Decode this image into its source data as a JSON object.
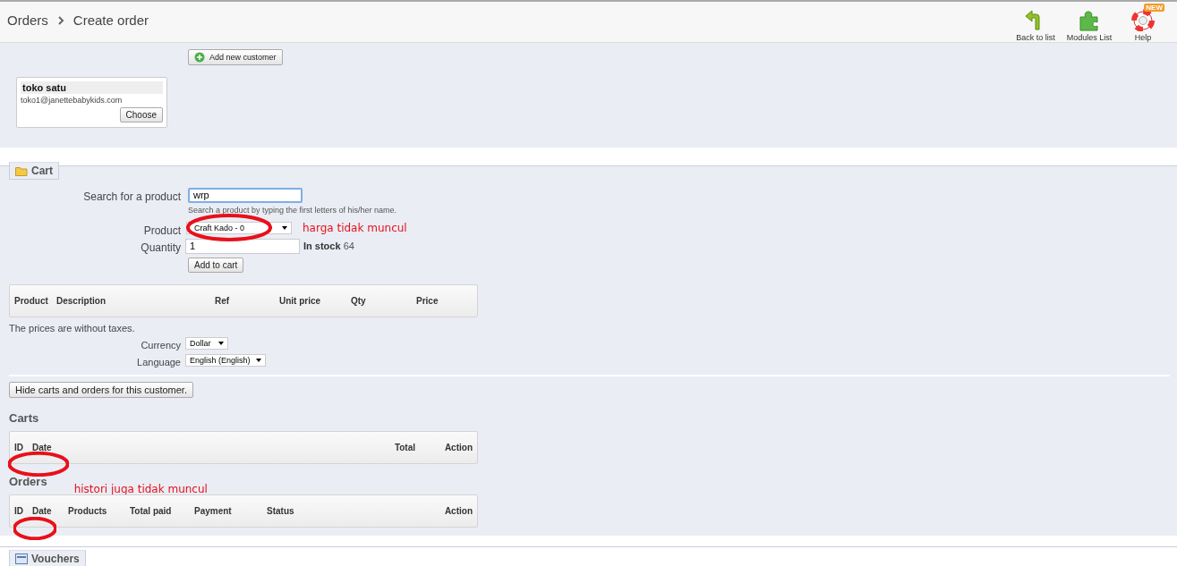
{
  "header": {
    "breadcrumb": [
      "Orders",
      "Create order"
    ],
    "toolbar": [
      {
        "kind": "back",
        "label": "Back to list"
      },
      {
        "kind": "modules",
        "label": "Modules List"
      },
      {
        "kind": "help",
        "label": "Help",
        "badge": "NEW"
      }
    ]
  },
  "customer": {
    "add_button": "Add new customer",
    "results": [
      {
        "name": "toko satu",
        "email": "toko1@janettebabykids.com",
        "button": "Choose"
      }
    ]
  },
  "cart": {
    "legend": "Cart",
    "search_label": "Search for a product",
    "search_value": "wrp",
    "search_help": "Search a product by typing the first letters of his/her name.",
    "product_label": "Product",
    "product_value": "Craft Kado - 0",
    "quantity_label": "Quantity",
    "quantity_value": "1",
    "stock_label": "In stock",
    "stock_value": "64",
    "add_button": "Add to cart",
    "product_marks": [
      {
        "kind": "ellipse"
      },
      {
        "kind": "note",
        "text": "harga tidak muncul"
      }
    ],
    "table_columns": [
      "Product",
      "Description",
      "Ref",
      "Unit price",
      "Qty",
      "Price"
    ],
    "note": "The prices are without taxes.",
    "currency_label": "Currency",
    "currency_value": "Dollar",
    "language_label": "Language",
    "language_value": "English (English)"
  },
  "history": {
    "toggle_button": "Hide carts and orders for this customer.",
    "carts": {
      "title": "Carts",
      "columns": [
        "ID",
        "Date",
        "Total",
        "Action"
      ],
      "marks": [
        {
          "kind": "ellipse"
        }
      ]
    },
    "orders": {
      "title": "Orders",
      "title_marks": [
        {
          "kind": "note",
          "text": "histori juga tidak muncul"
        }
      ],
      "columns": [
        "ID",
        "Date",
        "Products",
        "Total paid",
        "Payment",
        "Status",
        "Action"
      ],
      "marks": [
        {
          "kind": "ellipse"
        }
      ]
    }
  },
  "vouchers": {
    "legend": "Vouchers"
  }
}
